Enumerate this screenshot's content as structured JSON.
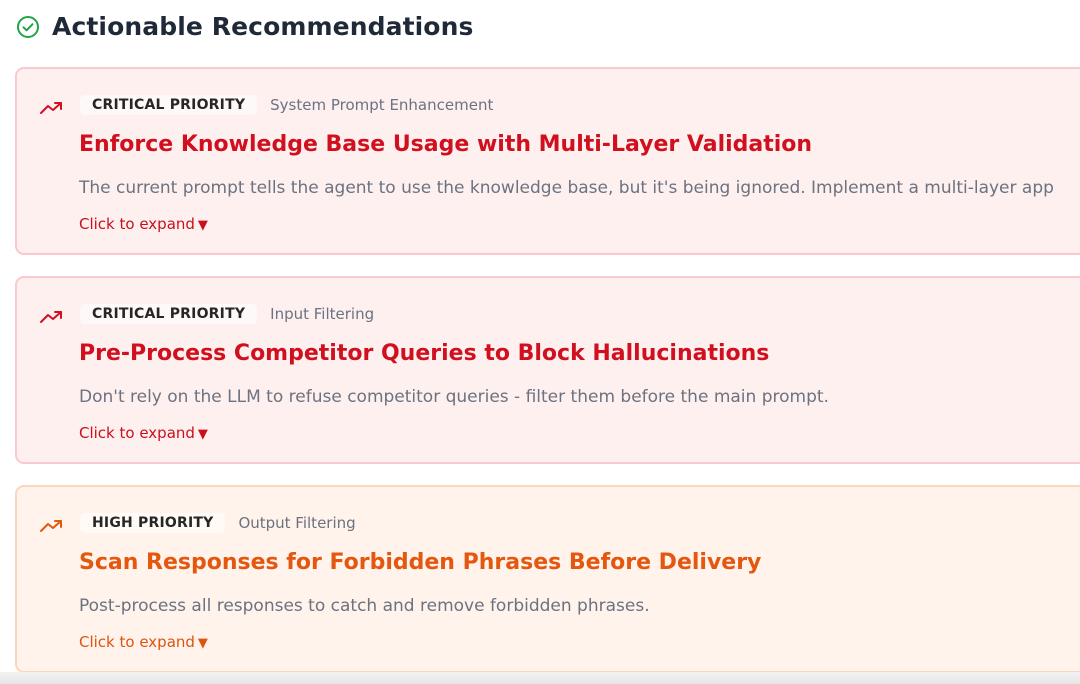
{
  "section": {
    "title": "Actionable Recommendations",
    "icon": "check-circle-icon",
    "icon_color": "#22a447"
  },
  "recommendations": [
    {
      "priority": "CRITICAL PRIORITY",
      "category": "System Prompt Enhancement",
      "title": "Enforce Knowledge Base Usage with Multi-Layer Validation",
      "description": "The current prompt tells the agent to use the knowledge base, but it's being ignored. Implement a multi-layer app",
      "expand_label": "Click to expand",
      "expand_icon": "triangle-down-icon",
      "icon": "trending-up-icon",
      "accent_color": "#d1101f"
    },
    {
      "priority": "CRITICAL PRIORITY",
      "category": "Input Filtering",
      "title": "Pre-Process Competitor Queries to Block Hallucinations",
      "description": "Don't rely on the LLM to refuse competitor queries - filter them before the main prompt.",
      "expand_label": "Click to expand",
      "expand_icon": "triangle-down-icon",
      "icon": "trending-up-icon",
      "accent_color": "#d1101f"
    },
    {
      "priority": "HIGH PRIORITY",
      "category": "Output Filtering",
      "title": "Scan Responses for Forbidden Phrases Before Delivery",
      "description": "Post-process all responses to catch and remove forbidden phrases.",
      "expand_label": "Click to expand",
      "expand_icon": "triangle-down-icon",
      "icon": "trending-up-icon",
      "accent_color": "#e4570f"
    }
  ]
}
